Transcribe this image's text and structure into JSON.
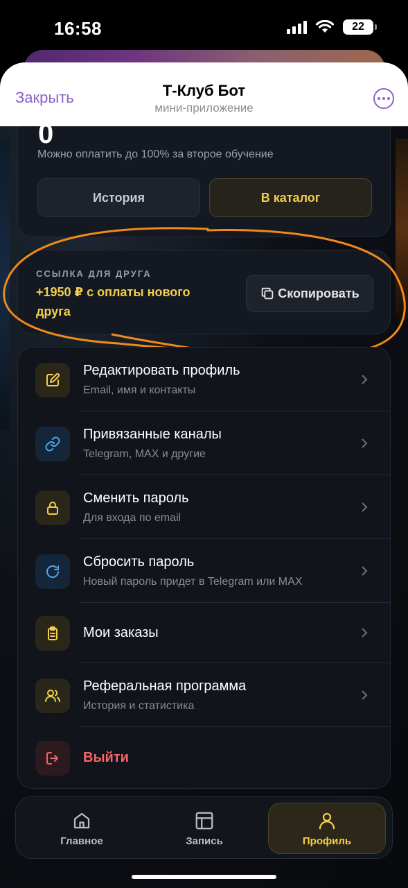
{
  "status_bar": {
    "time": "16:58",
    "battery": "22",
    "icons": [
      "signal-icon",
      "wifi-icon",
      "battery-icon"
    ]
  },
  "telegram_header": {
    "close_label": "Закрыть",
    "title": "Т-Клуб Бот",
    "subtitle": "мини-приложение",
    "more_icon": "more-icon"
  },
  "balance": {
    "value": "0",
    "note": "Можно оплатить до 100% за второе обучение",
    "history_button": "История",
    "catalog_button": "В каталог"
  },
  "referral": {
    "label": "ССЫЛКА ДЛЯ ДРУГА",
    "bonus": "+1950 ₽ с оплаты нового друга",
    "copy_button": "Скопировать",
    "copy_icon": "copy-icon"
  },
  "menu": {
    "items": [
      {
        "title": "Редактировать профиль",
        "subtitle": "Email, имя и контакты",
        "icon": "edit-icon"
      },
      {
        "title": "Привязанные каналы",
        "subtitle": "Telegram, MAX и другие",
        "icon": "link-icon"
      },
      {
        "title": "Сменить пароль",
        "subtitle": "Для входа по email",
        "icon": "lock-icon"
      },
      {
        "title": "Сбросить пароль",
        "subtitle": "Новый пароль придет в Telegram или MAX",
        "icon": "refresh-icon"
      },
      {
        "title": "Мои заказы",
        "subtitle": "",
        "icon": "clipboard-icon"
      },
      {
        "title": "Реферальная программа",
        "subtitle": "История и статистика",
        "icon": "users-icon"
      },
      {
        "title": "Выйти",
        "subtitle": "",
        "icon": "logout-icon"
      }
    ]
  },
  "tabs": [
    {
      "label": "Главное",
      "icon": "home-icon",
      "active": false
    },
    {
      "label": "Запись",
      "icon": "layout-icon",
      "active": false
    },
    {
      "label": "Профиль",
      "icon": "user-icon",
      "active": true
    }
  ],
  "colors": {
    "accent_gold": "#f3cf4d",
    "telegram_purple": "#8f5ec9",
    "logout_red": "#f2666a",
    "annotation_orange": "#f08a1c"
  }
}
